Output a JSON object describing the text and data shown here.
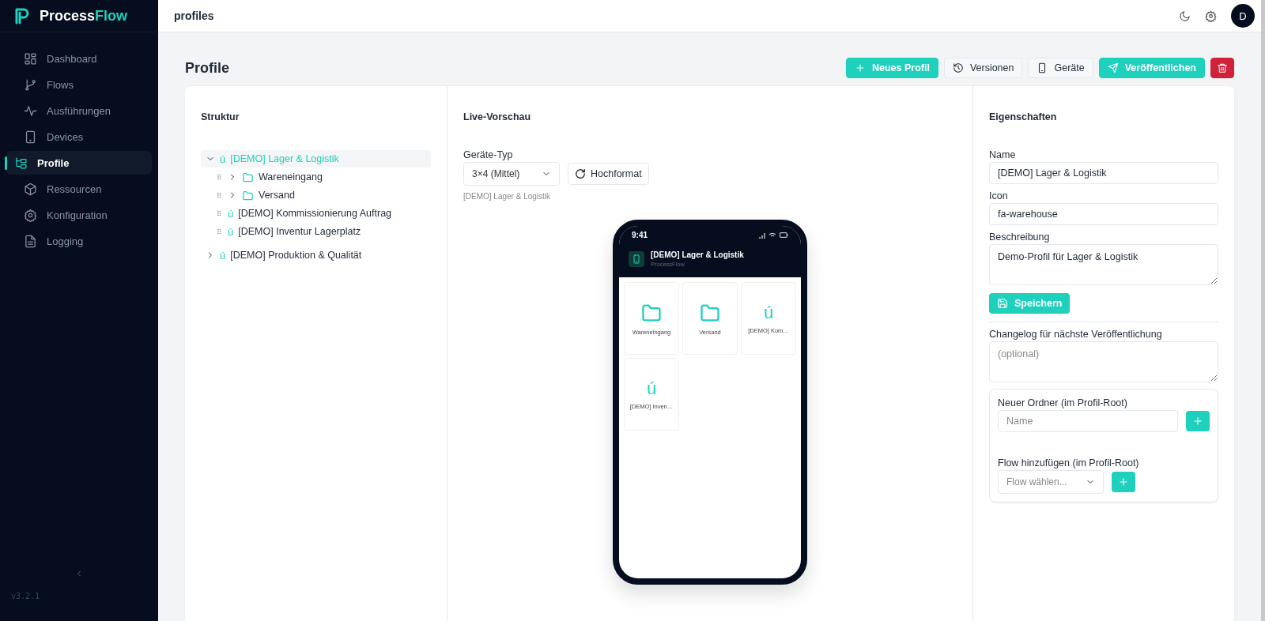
{
  "brand": {
    "parts": [
      "Process",
      "Flow"
    ]
  },
  "sidebar": {
    "items": [
      {
        "label": "Dashboard",
        "selected": false
      },
      {
        "label": "Flows",
        "selected": false
      },
      {
        "label": "Ausführungen",
        "selected": false
      },
      {
        "label": "Devices",
        "selected": false
      },
      {
        "label": "Profile",
        "selected": true
      },
      {
        "label": "Ressourcen",
        "selected": false
      },
      {
        "label": "Konfiguration",
        "selected": false
      },
      {
        "label": "Logging",
        "selected": false
      }
    ],
    "version": "v3.2.1"
  },
  "topbar": {
    "title": "profiles",
    "avatar": "D"
  },
  "page": {
    "title": "Profile",
    "actions": [
      {
        "label": "Neues Profil",
        "kind": "primary"
      },
      {
        "label": "Versionen",
        "kind": "secondary"
      },
      {
        "label": "Geräte",
        "kind": "secondary"
      },
      {
        "label": "Veröffentlichen",
        "kind": "primary"
      },
      {
        "kind": "danger"
      }
    ]
  },
  "structure": {
    "title": "Struktur",
    "tree": [
      {
        "kind": "profile",
        "glyph": "ú",
        "label": "[DEMO] Lager & Logistik",
        "expanded": true,
        "selected": true,
        "children": [
          {
            "kind": "folder",
            "label": "Wareneingang",
            "expanded": false,
            "selected": false
          },
          {
            "kind": "folder",
            "label": "Versand",
            "expanded": false,
            "selected": false
          },
          {
            "kind": "flow",
            "glyph": "ú",
            "label": "[DEMO] Kommissionierung Auftrag",
            "selected": false
          },
          {
            "kind": "flow",
            "glyph": "ú",
            "label": "[DEMO] Inventur Lagerplatz",
            "selected": false
          }
        ]
      },
      {
        "kind": "profile",
        "glyph": "ú",
        "label": "[DEMO] Produktion & Qualität",
        "expanded": false,
        "selected": false
      }
    ]
  },
  "preview": {
    "title": "Live-Vorschau",
    "device_label": "Geräte-Typ",
    "device_value": "3×4 (Mittel)",
    "orientation": "Hochformat",
    "caption": "[DEMO] Lager & Logistik",
    "phone": {
      "time": "9:41",
      "title": "[DEMO] Lager & Logistik",
      "subtitle": "ProcessFlow",
      "tiles": [
        {
          "kind": "folder",
          "label": "Wareneingang"
        },
        {
          "kind": "folder",
          "label": "Versand"
        },
        {
          "kind": "flow",
          "glyph": "ú",
          "label": "[DEMO] Kom…"
        },
        {
          "kind": "flow",
          "glyph": "ú",
          "label": "[DEMO] Inven…"
        }
      ]
    }
  },
  "properties": {
    "title": "Eigenschaften",
    "fields": [
      {
        "label": "Name",
        "value": "[DEMO] Lager & Logistik",
        "kind": "input"
      },
      {
        "label": "Icon",
        "value": "fa-warehouse",
        "kind": "input"
      },
      {
        "label": "Beschreibung",
        "value": "Demo-Profil für Lager & Logistik",
        "kind": "textarea"
      }
    ],
    "save": "Speichern",
    "changelog": {
      "label": "Changelog für nächste Veröffentlichung",
      "placeholder": "(optional)"
    },
    "new_folder": {
      "label": "Neuer Ordner (im Profil-Root)",
      "placeholder": "Name"
    },
    "add_flow": {
      "label": "Flow hinzufügen (im Profil-Root)",
      "placeholder": "Flow wählen..."
    }
  }
}
